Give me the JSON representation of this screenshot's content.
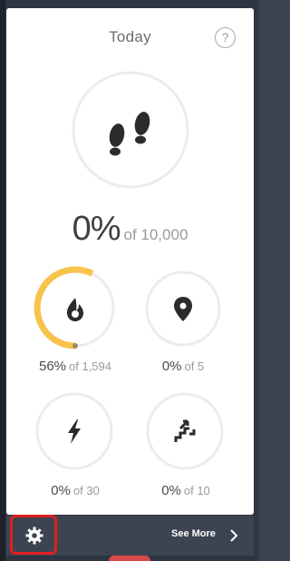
{
  "header": {
    "title": "Today",
    "help_symbol": "?"
  },
  "steps": {
    "percent": "0%",
    "goal_text": "of 10,000",
    "progress": 0,
    "icon": "footprints-icon"
  },
  "stats": [
    {
      "key": "calories",
      "percent": "56%",
      "goal_text": "of 1,594",
      "progress": 0.56,
      "icon": "flame-icon"
    },
    {
      "key": "distance",
      "percent": "0%",
      "goal_text": "of 5",
      "progress": 0,
      "icon": "location-pin-icon"
    },
    {
      "key": "active_minutes",
      "percent": "0%",
      "goal_text": "of 30",
      "progress": 0,
      "icon": "lightning-bolt-icon"
    },
    {
      "key": "floors",
      "percent": "0%",
      "goal_text": "of 10",
      "progress": 0,
      "icon": "stairs-icon"
    }
  ],
  "footer": {
    "see_more_label": "See More",
    "settings_icon": "gear-icon",
    "chevron_icon": "chevron-right-icon"
  },
  "colors": {
    "ring_track": "#ececec",
    "ring_progress": "#f7c34a",
    "highlight": "#e0201f",
    "icon": "#2b2b2b"
  }
}
